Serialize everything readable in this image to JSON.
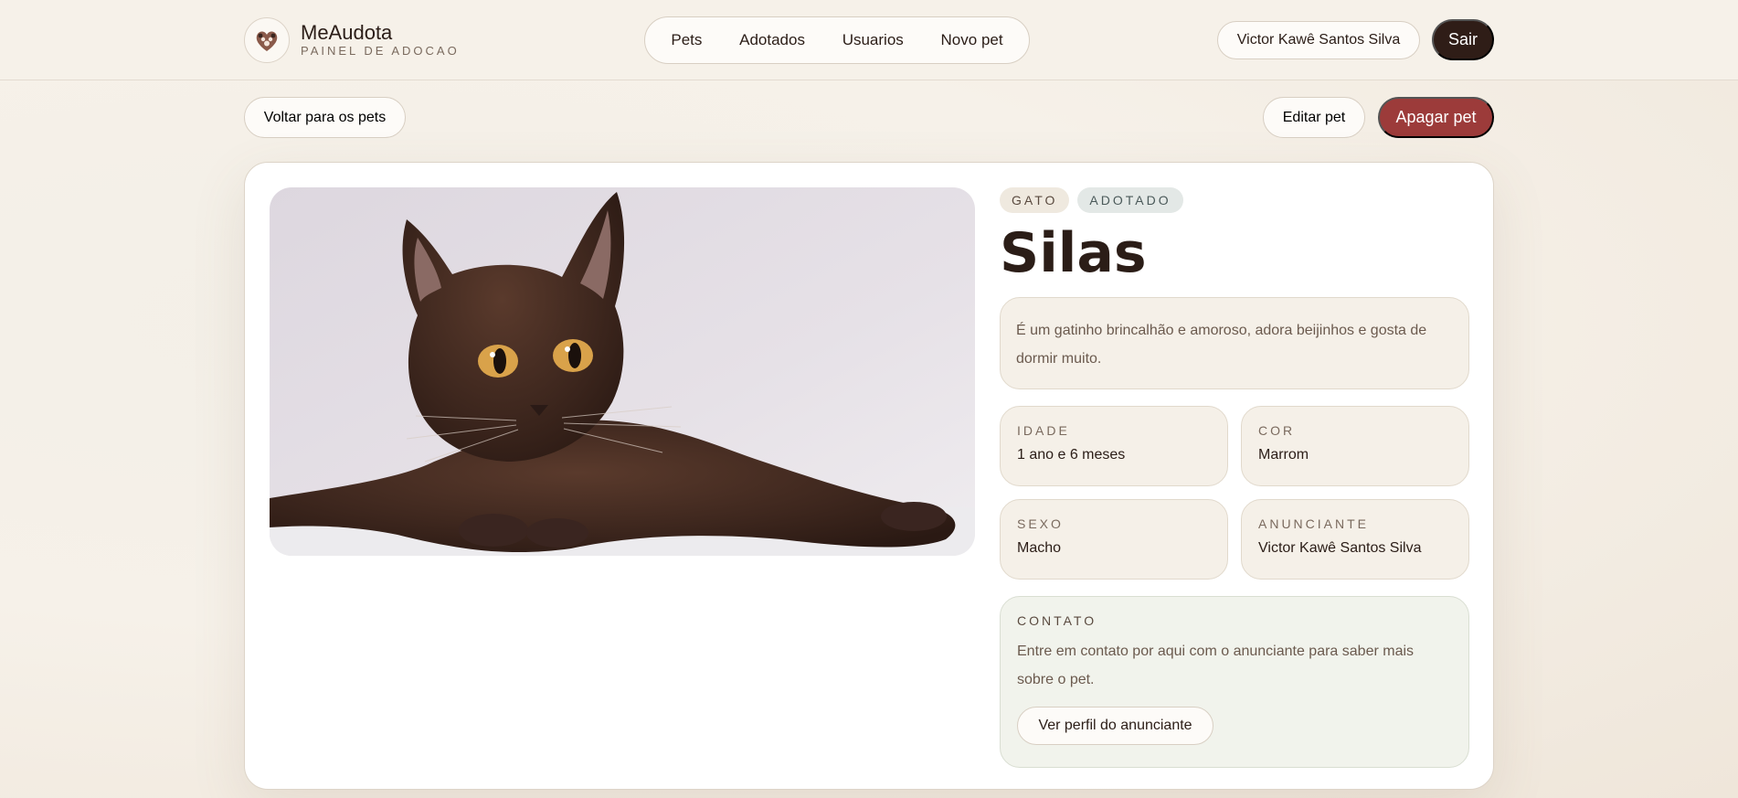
{
  "header": {
    "brand_name": "MeAudota",
    "brand_subtitle": "PAINEL DE ADOCAO",
    "nav": [
      {
        "label": "Pets"
      },
      {
        "label": "Adotados"
      },
      {
        "label": "Usuarios"
      },
      {
        "label": "Novo pet"
      }
    ],
    "user_name": "Victor Kawê Santos Silva",
    "logout_label": "Sair"
  },
  "actions": {
    "back_label": "Voltar para os pets",
    "edit_label": "Editar pet",
    "delete_label": "Apagar pet"
  },
  "pet": {
    "species_tag": "GATO",
    "status_tag": "ADOTADO",
    "name": "Silas",
    "description": "É um gatinho brincalhão e amoroso, adora beijinhos e gosta de dormir muito.",
    "fields": [
      {
        "label": "IDADE",
        "value": "1 ano e 6 meses"
      },
      {
        "label": "COR",
        "value": "Marrom"
      },
      {
        "label": "SEXO",
        "value": "Macho"
      },
      {
        "label": "ANUNCIANTE",
        "value": "Victor Kawê Santos Silva"
      }
    ],
    "contact": {
      "label": "CONTATO",
      "text": "Entre em contato por aqui com o anunciante para saber mais sobre o pet.",
      "button_label": "Ver perfil do anunciante"
    }
  },
  "colors": {
    "primary_dark": "#2f1d17",
    "danger": "#9c3b3a",
    "surface": "#f5f0e8",
    "contact_surface": "#f1f3ec"
  },
  "icons": {
    "brand": "paw-heart-icon"
  }
}
